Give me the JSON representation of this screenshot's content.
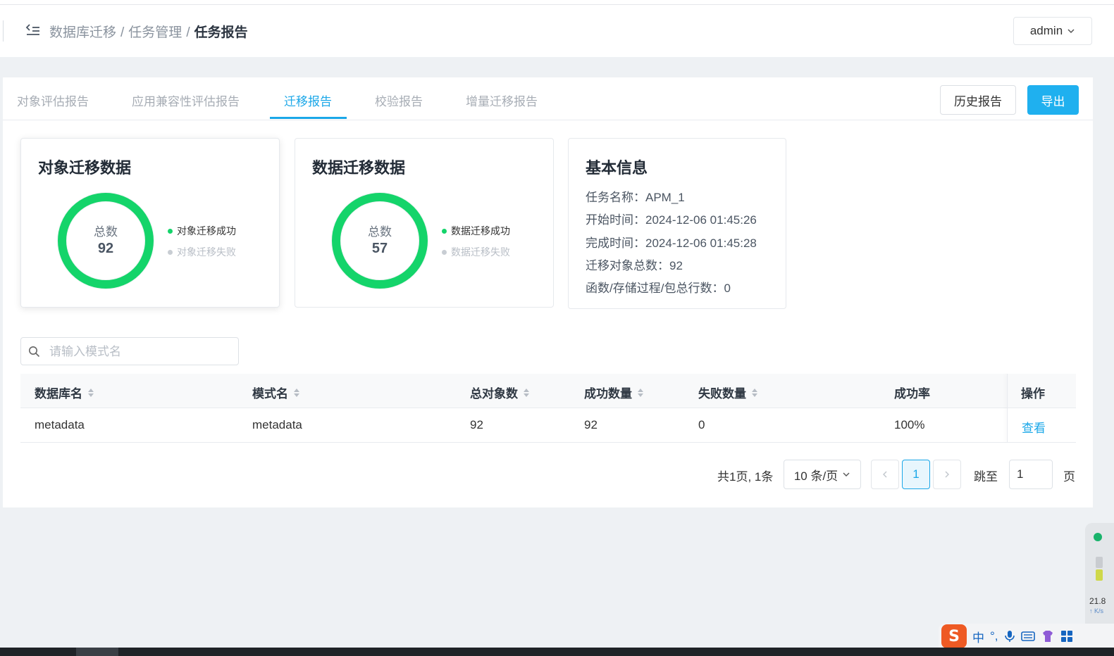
{
  "header": {
    "breadcrumb": [
      "数据库迁移",
      "任务管理",
      "任务报告"
    ],
    "separator": "/",
    "user": "admin"
  },
  "tabs": [
    {
      "label": "对象评估报告",
      "active": false
    },
    {
      "label": "应用兼容性评估报告",
      "active": false
    },
    {
      "label": "迁移报告",
      "active": true
    },
    {
      "label": "校验报告",
      "active": false
    },
    {
      "label": "增量迁移报告",
      "active": false
    }
  ],
  "actions": {
    "history": "历史报告",
    "export": "导出"
  },
  "object_card": {
    "title": "对象迁移数据",
    "total_label": "总数",
    "total": "92",
    "legend_success": "对象迁移成功",
    "legend_fail": "对象迁移失败",
    "success_ratio": 1.0
  },
  "data_card": {
    "title": "数据迁移数据",
    "total_label": "总数",
    "total": "57",
    "legend_success": "数据迁移成功",
    "legend_fail": "数据迁移失败",
    "success_ratio": 1.0
  },
  "info_card": {
    "title": "基本信息",
    "lines": [
      "任务名称：APM_1",
      "开始时间：2024-12-06 01:45:26",
      "完成时间：2024-12-06 01:45:28",
      "迁移对象总数：92",
      "函数/存储过程/包总行数：0"
    ]
  },
  "search": {
    "placeholder": "请输入模式名",
    "value": ""
  },
  "table": {
    "columns": [
      "数据库名",
      "模式名",
      "总对象数",
      "成功数量",
      "失败数量",
      "成功率",
      "操作"
    ],
    "rows": [
      [
        "metadata",
        "metadata",
        "92",
        "92",
        "0",
        "100%",
        "查看"
      ]
    ]
  },
  "pagination": {
    "summary": "共1页, 1条",
    "page_size": "10 条/页",
    "current_page": "1",
    "jump_label": "跳至",
    "jump_value": "1",
    "page_suffix": "页"
  },
  "system": {
    "ime_logo": "S",
    "ime_lang": "中",
    "ime_punct": "°,",
    "net_speed": "21.8",
    "net_unit": "↑ K/s"
  },
  "colors": {
    "accent": "#1aa7e8",
    "success": "#14d46a",
    "fail": "#c8cdd3"
  }
}
